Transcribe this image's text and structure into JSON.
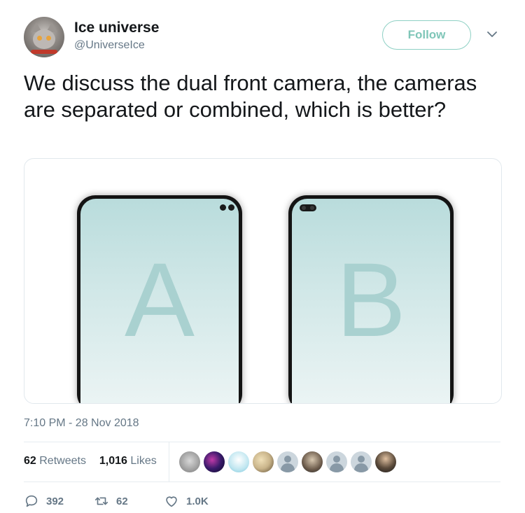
{
  "user": {
    "name": "Ice universe",
    "handle": "@UniverseIce",
    "avatar_icon": "cat-avatar"
  },
  "follow": {
    "label": "Follow",
    "color": "#7fc6b8"
  },
  "tweet": {
    "text": "We discuss the dual front camera, the cameras are separated or combined, which is better?"
  },
  "media": {
    "phone_a_label": "A",
    "phone_b_label": "B",
    "screen_colors": [
      "#b9dcdc",
      "#edf5f5"
    ]
  },
  "timestamp": "7:10 PM - 28 Nov 2018",
  "stats": {
    "retweets_count": "62",
    "retweets_label": "Retweets",
    "likes_count": "1,016",
    "likes_label": "Likes"
  },
  "likers": [
    {
      "icon": "cat-avatar",
      "color": "#9a9a9a"
    },
    {
      "icon": "galaxy-avatar",
      "color": "#3a1a6b"
    },
    {
      "icon": "anime-avatar",
      "color": "#bfe6f0"
    },
    {
      "icon": "photo-avatar",
      "color": "#c9b48a"
    },
    {
      "icon": "default-avatar",
      "color": "#ccd6dd"
    },
    {
      "icon": "person-avatar",
      "color": "#6b5a4a"
    },
    {
      "icon": "default-avatar",
      "color": "#ccd6dd"
    },
    {
      "icon": "default-avatar",
      "color": "#ccd6dd"
    },
    {
      "icon": "portrait-avatar",
      "color": "#5a4a3a"
    }
  ],
  "actions": {
    "replies": "392",
    "retweets": "62",
    "likes": "1.0K"
  }
}
